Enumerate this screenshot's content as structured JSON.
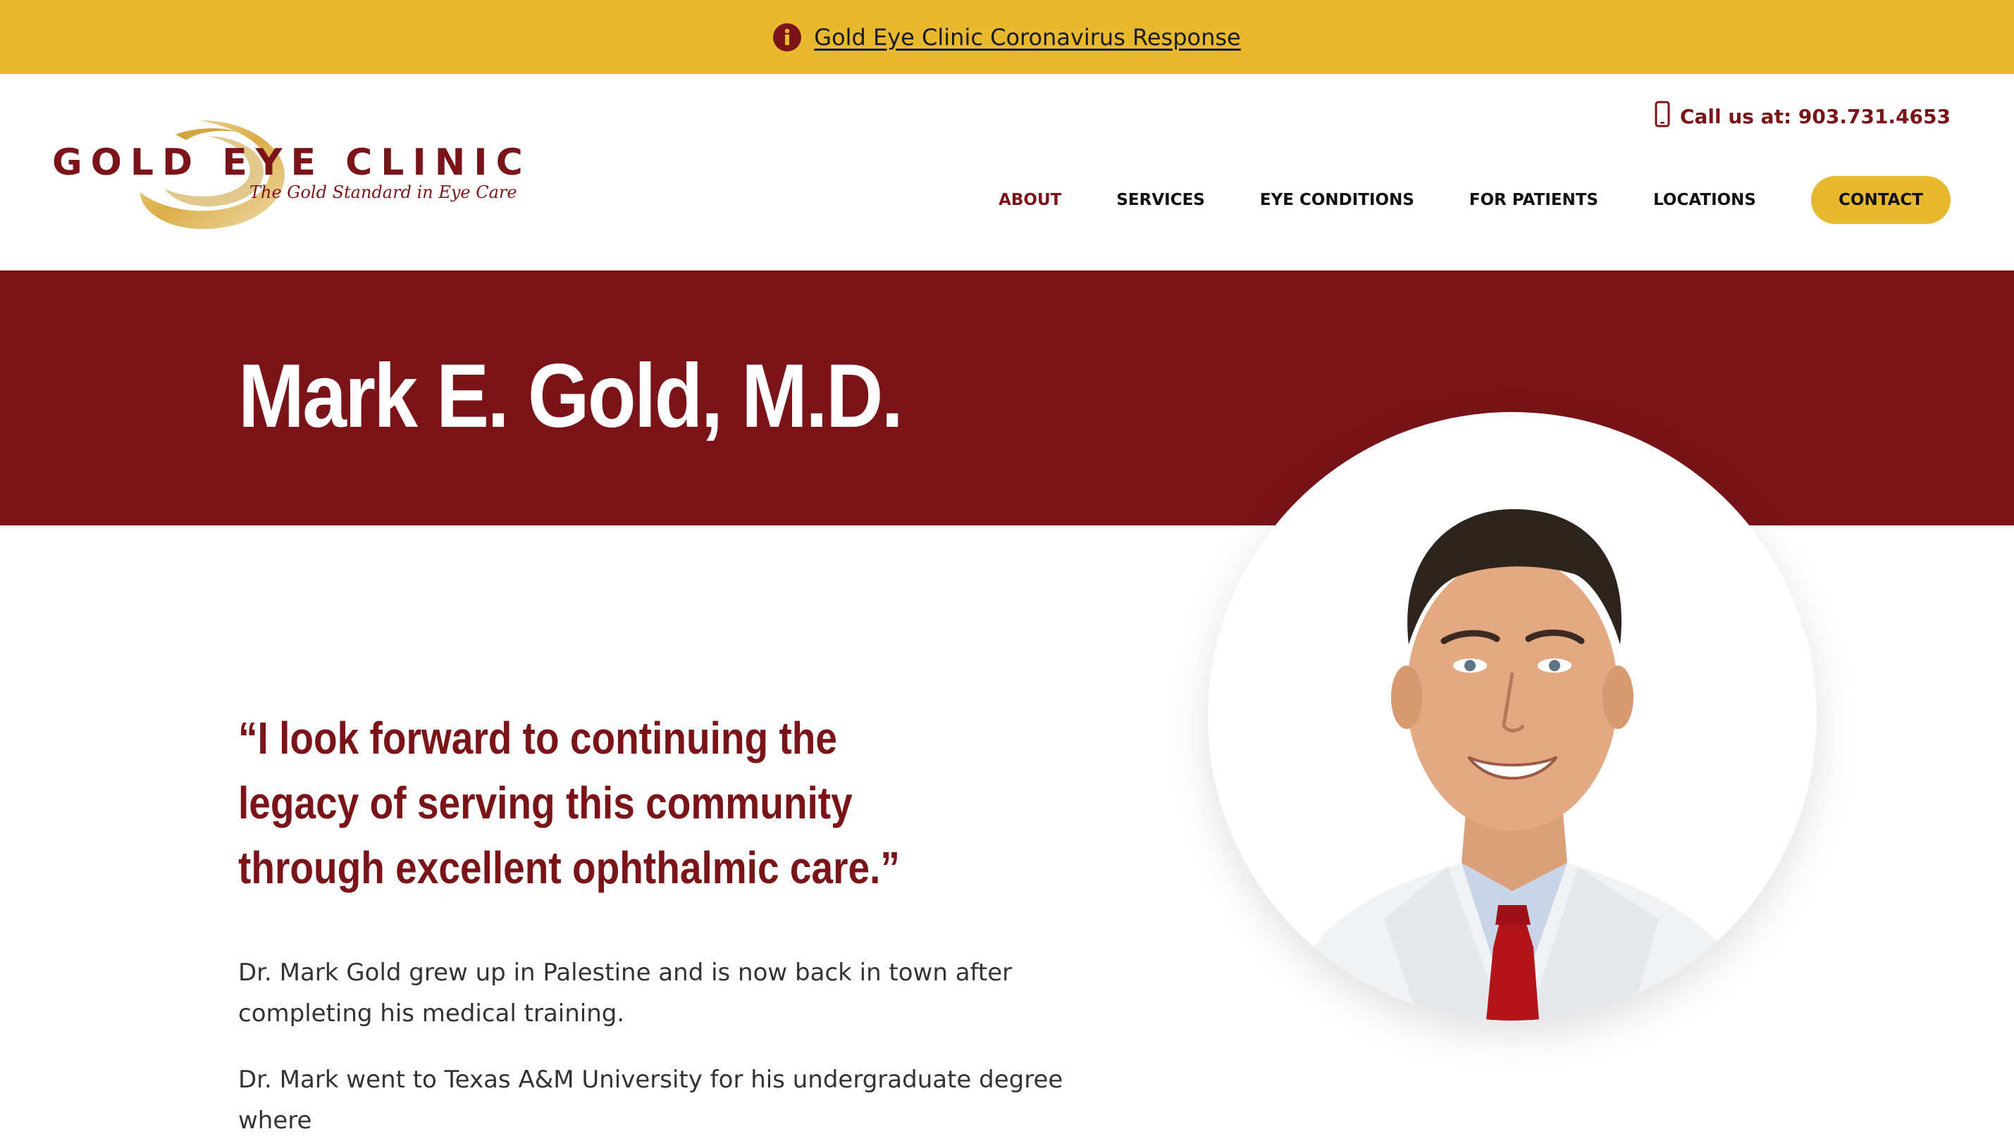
{
  "alert": {
    "text": "Gold Eye Clinic Coronavirus Response",
    "icon": "info-icon"
  },
  "logo": {
    "name": "GOLD EYE CLINIC",
    "tagline": "The Gold Standard in Eye Care"
  },
  "header": {
    "phone_label": "Call us at: 903.731.4653",
    "phone_icon": "mobile-phone-icon"
  },
  "nav": {
    "items": [
      "ABOUT",
      "SERVICES",
      "EYE CONDITIONS",
      "FOR PATIENTS",
      "LOCATIONS"
    ],
    "active": "ABOUT",
    "contact": "CONTACT"
  },
  "hero": {
    "title": "Mark E. Gold, M.D."
  },
  "content": {
    "quote": "“I look forward to continuing the legacy of serving this community through excellent ophthalmic care.”",
    "paragraphs": [
      "Dr. Mark Gold grew up in Palestine and is now back in town after completing his medical training.",
      "Dr. Mark went to Texas A&M University for his undergraduate degree where"
    ]
  },
  "colors": {
    "brand_maroon": "#7B1419",
    "brand_gold": "#E8B82E",
    "text": "#333333"
  }
}
